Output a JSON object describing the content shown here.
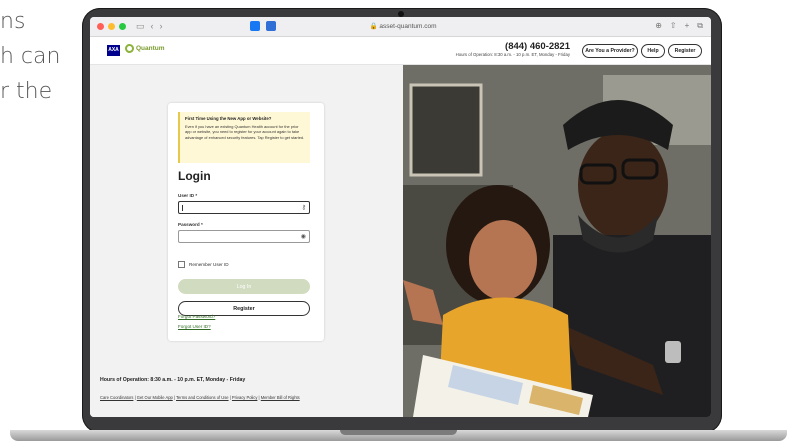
{
  "background_text": [
    "ns",
    "h can",
    "r the"
  ],
  "browser": {
    "url": "asset-quantum.com"
  },
  "header": {
    "brand_logo": "AXA",
    "site_logo": "Quantum",
    "phone": "(844) 460-2821",
    "hours": "Hours of Operation: 8:30 a.m. - 10 p.m. ET, Monday - Friday",
    "buttons": [
      "Are You a Provider?",
      "Help",
      "Register"
    ]
  },
  "login": {
    "notice_title": "First Time Using the New App or Website?",
    "notice_body": "Even if you have an existing Quantum Health account for the prior app or website, you need to register for your account again to take advantage of enhanced security features. Tap Register to get started.",
    "title": "Login",
    "userid_label": "User ID *",
    "password_label": "Password *",
    "remember_label": "Remember User ID",
    "login_button": "Log In",
    "register_button": "Register",
    "forgot_password": "Forgot Password?",
    "forgot_userid": "Forgot User ID?"
  },
  "footer": {
    "hours": "Hours of Operation: 8:30 a.m. - 10 p.m. ET, Monday - Friday",
    "links": [
      "Care Coordinators",
      "Get Our Mobile App",
      "Terms and Conditions of Use",
      "Privacy Policy",
      "Member Bill of Rights"
    ]
  },
  "colors": {
    "accent_green": "#8bb33a",
    "login_button_disabled": "#d1dbc0",
    "notice_bg": "#fff8d6",
    "axa_blue": "#00008f"
  }
}
